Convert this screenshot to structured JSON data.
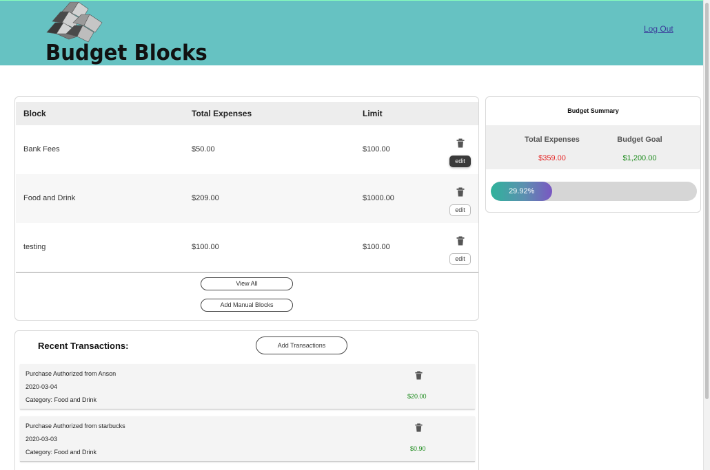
{
  "header": {
    "brand": "Budget Blocks",
    "logout_label": "Log Out",
    "background_color": "#66c2c2"
  },
  "blocks": {
    "columns": [
      "Block",
      "Total Expenses",
      "Limit"
    ],
    "rows": [
      {
        "name": "Bank Fees",
        "expenses": "$50.00",
        "limit": "$100.00",
        "edit_label": "edit"
      },
      {
        "name": "Food and Drink",
        "expenses": "$209.00",
        "limit": "$1000.00",
        "edit_label": "edit"
      },
      {
        "name": "testing",
        "expenses": "$100.00",
        "limit": "$100.00",
        "edit_label": "edit"
      }
    ],
    "view_all_label": "View All",
    "add_manual_label": "Add Manual Blocks",
    "trash_icon": "trash-icon"
  },
  "summary": {
    "title": "Budget Summary",
    "total_expenses_label": "Total Expenses",
    "total_expenses_value": "$359.00",
    "budget_goal_label": "Budget Goal",
    "budget_goal_value": "$1,200.00",
    "progress_percent": 29.92,
    "progress_text": "29.92%",
    "expense_color": "#e52222",
    "goal_color": "#1a8a1a"
  },
  "transactions": {
    "title": "Recent Transactions:",
    "add_label": "Add Transactions",
    "items": [
      {
        "description": "Purchase Authorized from Anson",
        "date": "2020-03-04",
        "category": "Category: Food and Drink",
        "amount": "$20.00"
      },
      {
        "description": "Purchase Authorized from starbucks",
        "date": "2020-03-03",
        "category": "Category: Food and Drink",
        "amount": "$0.90"
      }
    ]
  }
}
